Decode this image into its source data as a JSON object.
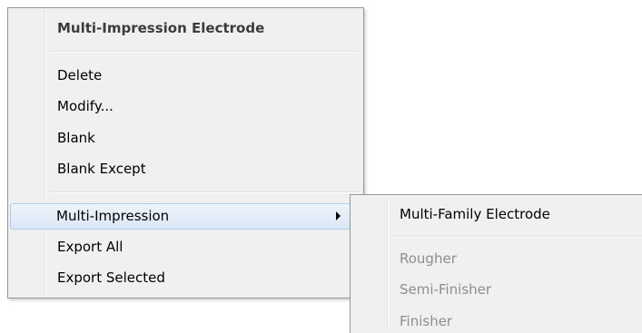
{
  "context_menu": {
    "header": "Multi-Impression Electrode",
    "items": [
      {
        "label": "Delete"
      },
      {
        "label": "Modify..."
      },
      {
        "label": "Blank"
      },
      {
        "label": "Blank Except"
      },
      {
        "label": "Multi-Impression",
        "has_submenu": true,
        "highlighted": true
      },
      {
        "label": "Export All"
      },
      {
        "label": "Export Selected"
      }
    ]
  },
  "submenu": {
    "header": "Multi-Family Electrode",
    "items": [
      {
        "label": "Rougher",
        "enabled": false
      },
      {
        "label": "Semi-Finisher",
        "enabled": false
      },
      {
        "label": "Finisher",
        "enabled": false
      }
    ]
  },
  "colors": {
    "menu_background": "#f0f0f0",
    "highlight_border": "#aecbf0",
    "disabled_text": "#8d8d8d"
  }
}
